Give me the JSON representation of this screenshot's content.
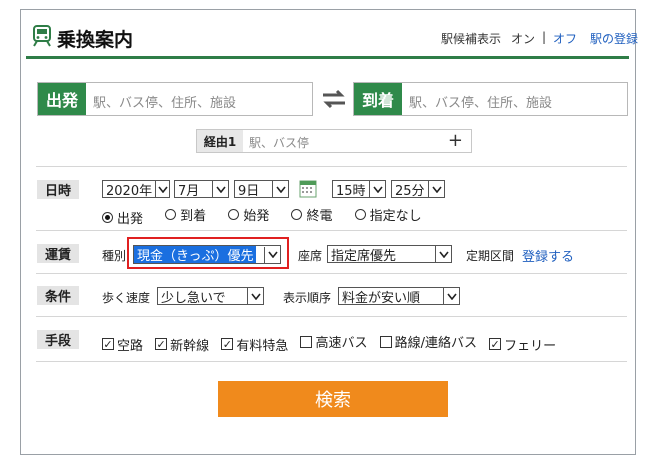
{
  "header": {
    "title": "乗換案内",
    "station_display_label": "駅候補表示",
    "on": "オン",
    "divider": "|",
    "off": "オフ",
    "register_station": "駅の登録"
  },
  "route": {
    "from_label": "出発",
    "from_placeholder": "駅、バス停、住所、施設",
    "to_label": "到着",
    "to_placeholder": "駅、バス停、住所、施設",
    "via_label": "経由1",
    "via_placeholder": "駅、バス停",
    "add": "+"
  },
  "datetime": {
    "label": "日時",
    "year": "2020年",
    "month": "7月",
    "day": "9日",
    "hour": "15時",
    "minute": "25分",
    "modes": [
      "出発",
      "到着",
      "始発",
      "終電",
      "指定なし"
    ],
    "selected_mode": "出発"
  },
  "fare": {
    "label": "運賃",
    "type_label": "種別",
    "type_value": "現金（きっぷ）優先",
    "seat_label": "座席",
    "seat_value": "指定席優先",
    "commuter_label": "定期区間",
    "commuter_link": "登録する"
  },
  "conditions": {
    "label": "条件",
    "walk_label": "歩く速度",
    "walk_value": "少し急いで",
    "order_label": "表示順序",
    "order_value": "料金が安い順"
  },
  "means": {
    "label": "手段",
    "options": [
      {
        "label": "空路",
        "checked": true
      },
      {
        "label": "新幹線",
        "checked": true
      },
      {
        "label": "有料特急",
        "checked": true
      },
      {
        "label": "高速バス",
        "checked": false
      },
      {
        "label": "路線/連絡バス",
        "checked": false
      },
      {
        "label": "フェリー",
        "checked": true
      }
    ]
  },
  "search_button": "検索",
  "colors": {
    "green": "#2f8a4a",
    "orange": "#f08a1c",
    "link": "#1f5fbf",
    "highlight": "#1a6fe0",
    "red_outline": "#e02020"
  }
}
